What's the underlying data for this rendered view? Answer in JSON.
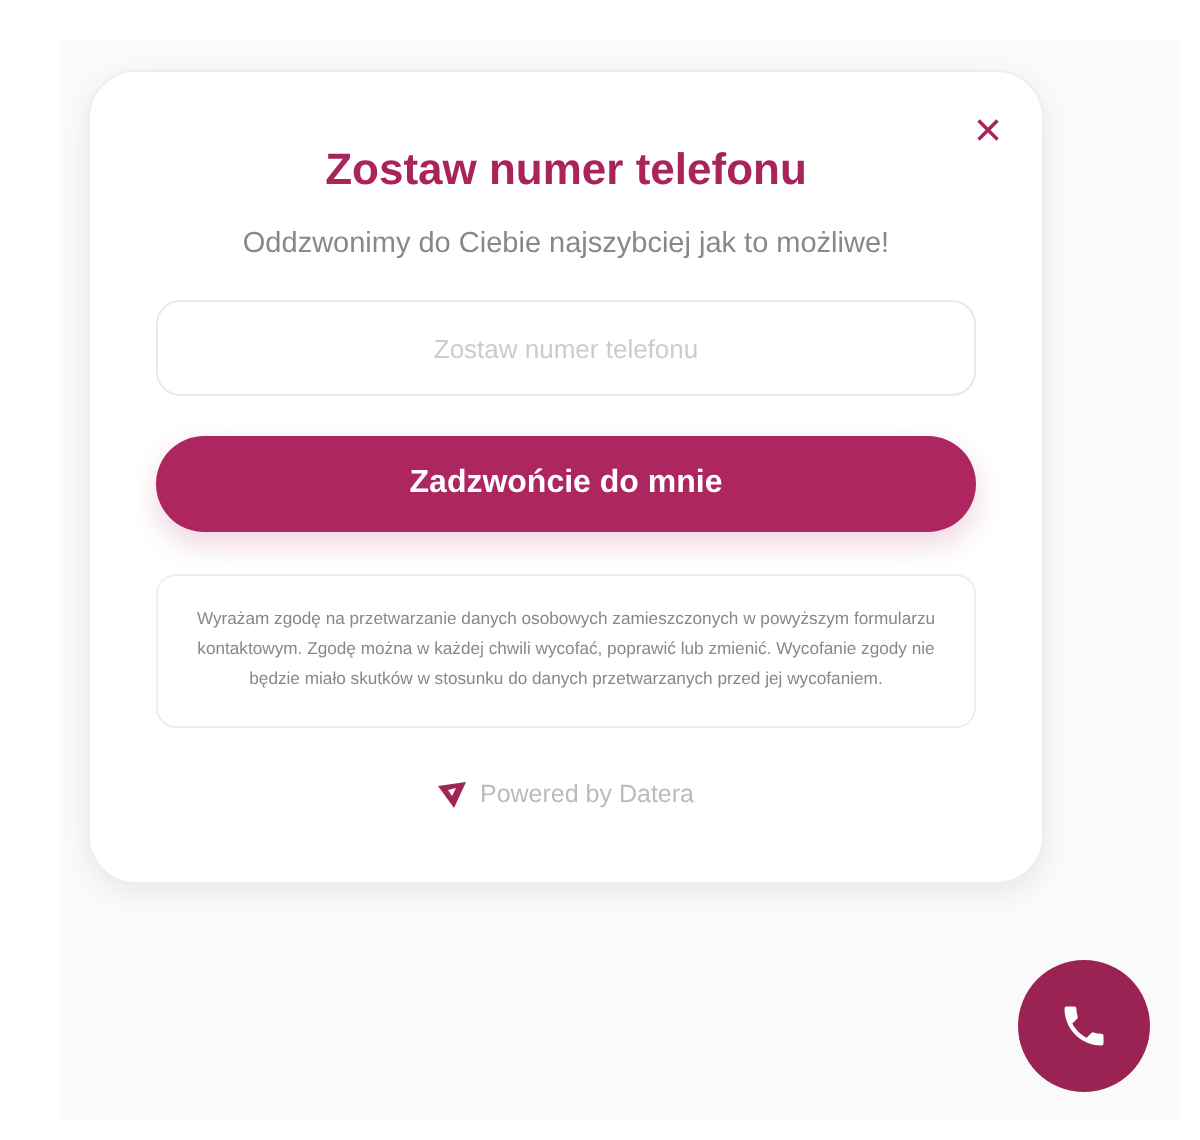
{
  "dialog": {
    "title": "Zostaw numer telefonu",
    "close_label": "×",
    "subtitle": "Oddzwonimy do Ciebie najszybciej jak to możliwe!"
  },
  "phone_field": {
    "placeholder": "Zostaw numer telefonu"
  },
  "submit_button": {
    "label": "Zadzwońcie do mnie"
  },
  "consent_text": "Wyrażam zgodę na przetwarzanie danych osobowych zamieszczonych w powyższym formularzu kontaktowym. Zgodę można w każdej chwili wycofać, poprawić lub zmienić. Wycofanie zgody nie będzie miało skutków w stosunku do danych przetwarzanych przed jej wycofaniem.",
  "footer": {
    "text": "Powered by Datera"
  }
}
